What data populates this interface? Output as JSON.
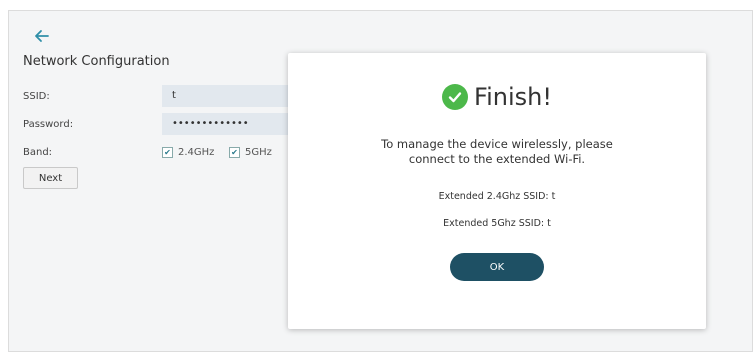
{
  "config": {
    "title": "Network Configuration",
    "ssid_label": "SSID:",
    "ssid_value": "t",
    "password_label": "Password:",
    "password_value": "•••••••••••••",
    "band_label": "Band:",
    "band_24_label": "2.4GHz",
    "band_5_label": "5GHz",
    "band_24_checked": true,
    "band_5_checked": true,
    "next_label": "Next"
  },
  "dialog": {
    "title": "Finish!",
    "message_line1": "To manage the device wirelessly, please",
    "message_line2": "connect to the extended Wi-Fi.",
    "ssid_24": "Extended 2.4Ghz SSID: t",
    "ssid_5": "Extended 5Ghz SSID: t",
    "ok_label": "OK"
  },
  "colors": {
    "accent": "#1e5064",
    "success": "#4cb84a",
    "input_bg": "#e2e8ee"
  },
  "icons": {
    "back": "arrow-left-icon",
    "success": "check-circle-icon",
    "checkbox": "checkbox-checked-icon"
  }
}
